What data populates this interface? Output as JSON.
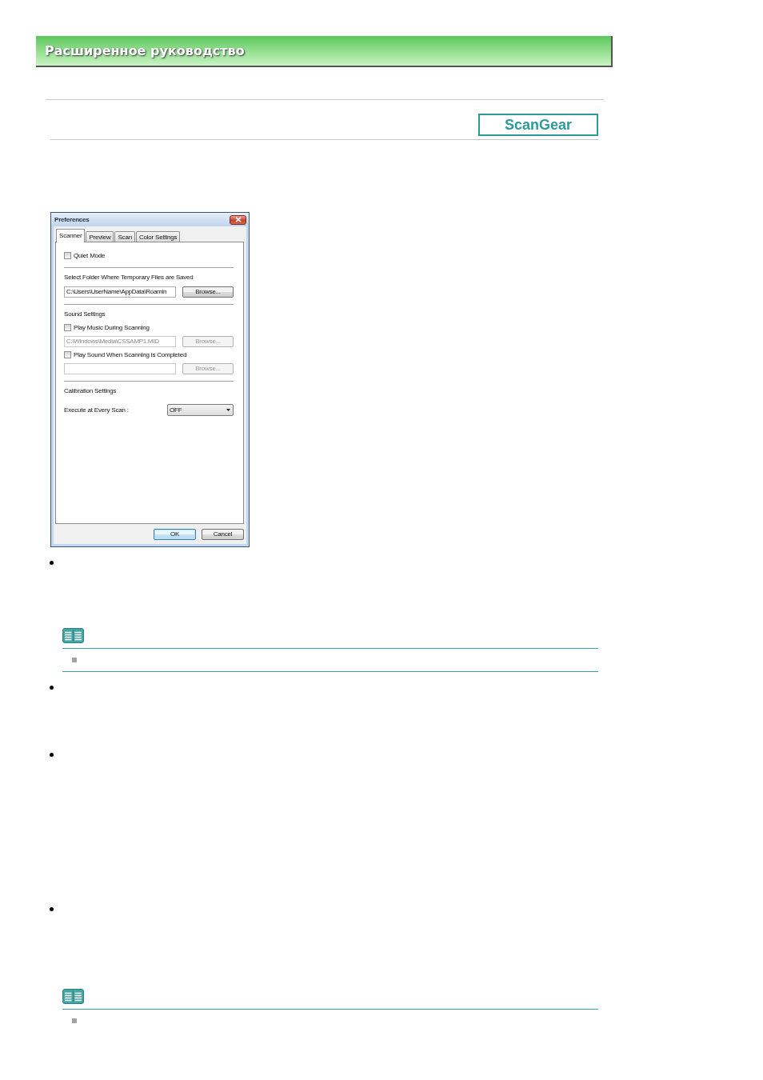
{
  "header": {
    "title": "Расширенное руководство"
  },
  "product_label": {
    "text": "ScanGear"
  },
  "dialog": {
    "title": "Preferences",
    "tabs": [
      {
        "label": "Scanner",
        "selected": true
      },
      {
        "label": "Preview",
        "selected": false
      },
      {
        "label": "Scan",
        "selected": false
      },
      {
        "label": "Color Settings",
        "selected": false
      }
    ],
    "sections": [
      {
        "items": [
          {
            "kind": "checkbox",
            "label": "Quiet Mode",
            "checked": false
          }
        ]
      },
      {
        "heading": "Select Folder Where Temporary Files are Saved",
        "items": [
          {
            "kind": "path",
            "value": "C:\\Users\\UserName\\AppData\\Roamin",
            "button": "Browse...",
            "disabled": false
          }
        ]
      },
      {
        "heading": "Sound Settings",
        "items": [
          {
            "kind": "checkbox",
            "label": "Play Music During Scanning",
            "checked": false
          },
          {
            "kind": "path",
            "value": "C:\\Windows\\Media\\CSSAMP1.MID",
            "button": "Browse...",
            "disabled": true
          },
          {
            "kind": "checkbox",
            "label": "Play Sound When Scanning is Completed",
            "checked": false
          },
          {
            "kind": "path",
            "button": "Browse...",
            "disabled": true
          }
        ]
      },
      {
        "heading": "Calibration Settings",
        "items": [
          {
            "kind": "select",
            "label": "Execute at Every Scan :",
            "value": "OFF"
          }
        ]
      }
    ],
    "buttons": [
      {
        "label": "OK",
        "default": true
      },
      {
        "label": "Cancel",
        "default": false
      }
    ]
  },
  "content": [
    {
      "kind": "bullet"
    },
    {
      "kind": "note",
      "entries": [
        {
          "kind": "square_bullet"
        }
      ],
      "bottom_rule": true
    },
    {
      "kind": "bullet"
    },
    {
      "kind": "bullet"
    },
    {
      "kind": "bullet"
    },
    {
      "kind": "note",
      "entries": [
        {
          "kind": "square_bullet"
        }
      ],
      "bottom_rule": false
    }
  ]
}
